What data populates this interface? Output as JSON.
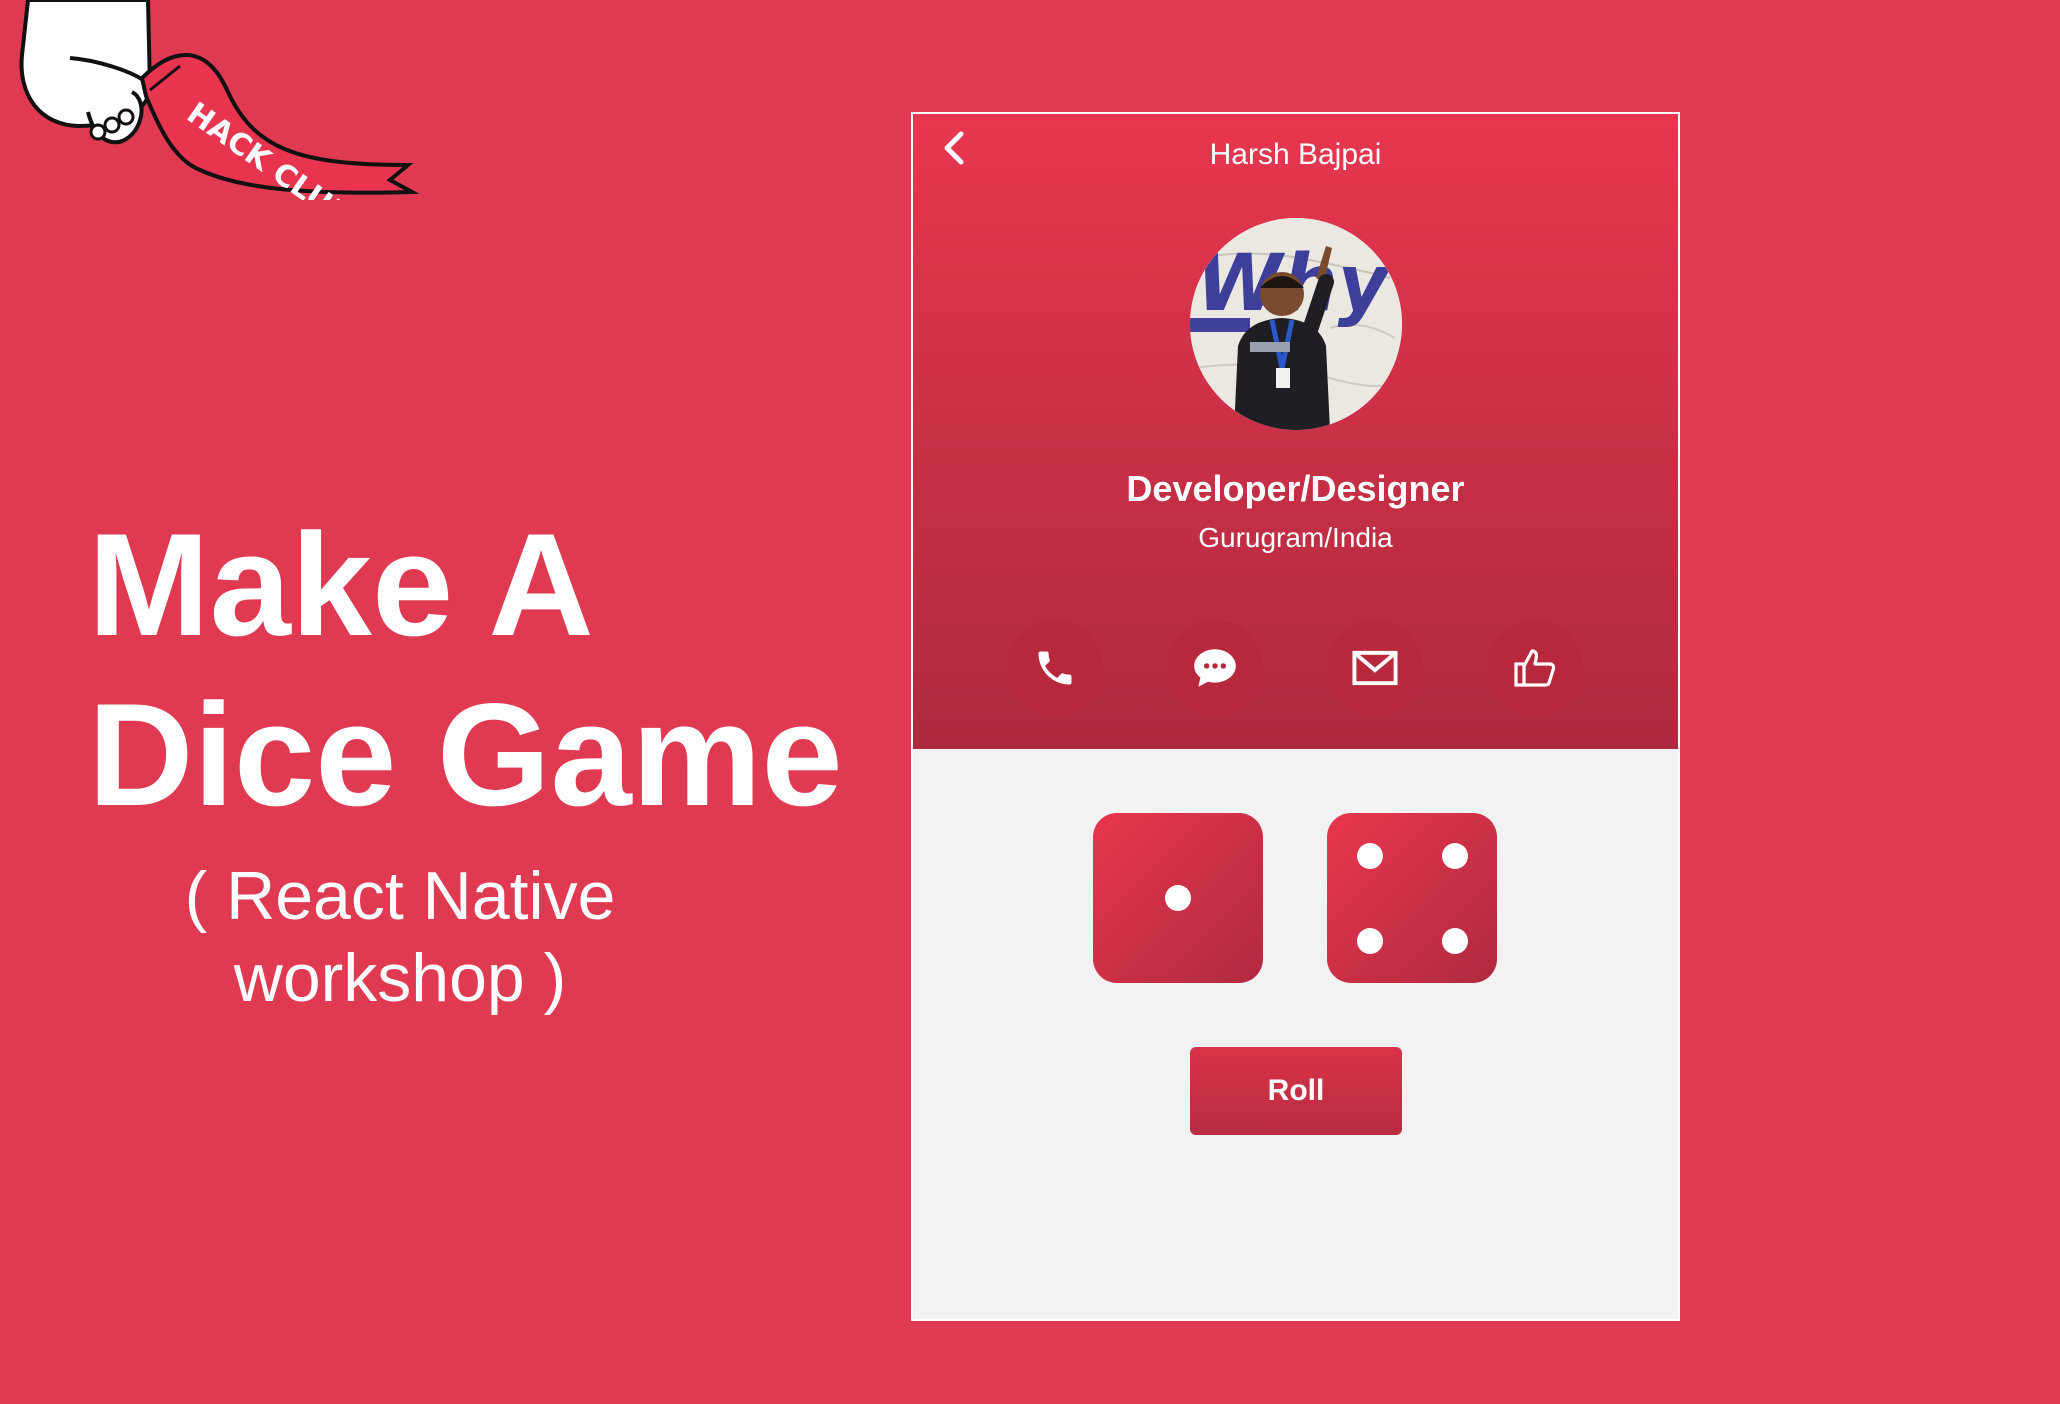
{
  "branding": {
    "logo_text": "HACK CLUB"
  },
  "slide": {
    "title_line1": "Make A",
    "title_line2": "Dice Game",
    "subtitle_line1": "( React Native",
    "subtitle_line2": "workshop )"
  },
  "app": {
    "header": {
      "back_icon": "chevron-left-icon",
      "name": "Harsh Bajpai"
    },
    "profile": {
      "avatar_sign_text": "Why",
      "role": "Developer/Designer",
      "location": "Gurugram/India"
    },
    "actions": [
      {
        "icon": "phone-icon"
      },
      {
        "icon": "chat-bubble-icon"
      },
      {
        "icon": "mail-icon"
      },
      {
        "icon": "thumbs-up-icon"
      }
    ],
    "dice": [
      {
        "value": 1
      },
      {
        "value": 4
      }
    ],
    "roll_label": "Roll"
  },
  "colors": {
    "background": "#e03a52",
    "header_top": "#e8364f",
    "header_bottom": "#ae2a3e",
    "panel": "#f2f2f2",
    "action_circle": "#b8283c",
    "text": "#ffffff"
  }
}
